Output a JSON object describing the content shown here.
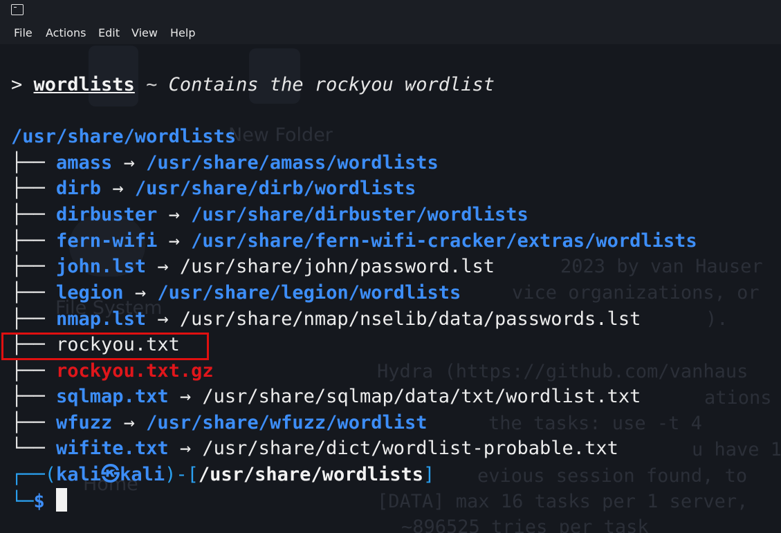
{
  "menu": [
    "File",
    "Actions",
    "Edit",
    "View",
    "Help"
  ],
  "header": {
    "prompt": "> ",
    "command": "wordlists",
    "separator": " ~ ",
    "description": "Contains the rockyou wordlist"
  },
  "directory": "/usr/share/wordlists",
  "arrow": " → ",
  "entries": [
    {
      "name": "amass",
      "target": "/usr/share/amass/wordlists"
    },
    {
      "name": "dirb",
      "target": "/usr/share/dirb/wordlists"
    },
    {
      "name": "dirbuster",
      "target": "/usr/share/dirbuster/wordlists"
    },
    {
      "name": "fern-wifi",
      "target": "/usr/share/fern-wifi-cracker/extras/wordlists"
    },
    {
      "name": "john.lst",
      "target": "/usr/share/john/password.lst"
    },
    {
      "name": "legion",
      "target": "/usr/share/legion/wordlists"
    },
    {
      "name": "nmap.lst",
      "target": "/usr/share/nmap/nselib/data/passwords.lst"
    },
    {
      "name": "rockyou.txt",
      "target": ""
    },
    {
      "name": "rockyou.txt.gz",
      "target": ""
    },
    {
      "name": "sqlmap.txt",
      "target": "/usr/share/sqlmap/data/txt/wordlist.txt"
    },
    {
      "name": "wfuzz",
      "target": "/usr/share/wfuzz/wordlist"
    },
    {
      "name": "wifite.txt",
      "target": "/usr/share/dict/wordlist-probable.txt"
    }
  ],
  "prompt": {
    "user": "kali",
    "at": "㉿",
    "host": "kali",
    "cwd": "/usr/share/wordlists",
    "symbol": "$"
  },
  "background_text": {
    "new_folder": "New Folder",
    "file_system": "File System",
    "home": "Home",
    "lines": [
      "2023 by van Hauser",
      "vice organizations, or",
      ").",
      "Hydra (https://github.com/vanhaus",
      "ations",
      "the tasks: use -t 4",
      "u have 1",
      "evious session found, to",
      "[DATA] max 16 tasks per 1 server,",
      "~896525 tries per task"
    ]
  },
  "colors": {
    "background": "#15181e",
    "directory_blue": "#3d8ef8",
    "archive_red": "#e0161b",
    "highlight_box": "#e01010"
  }
}
